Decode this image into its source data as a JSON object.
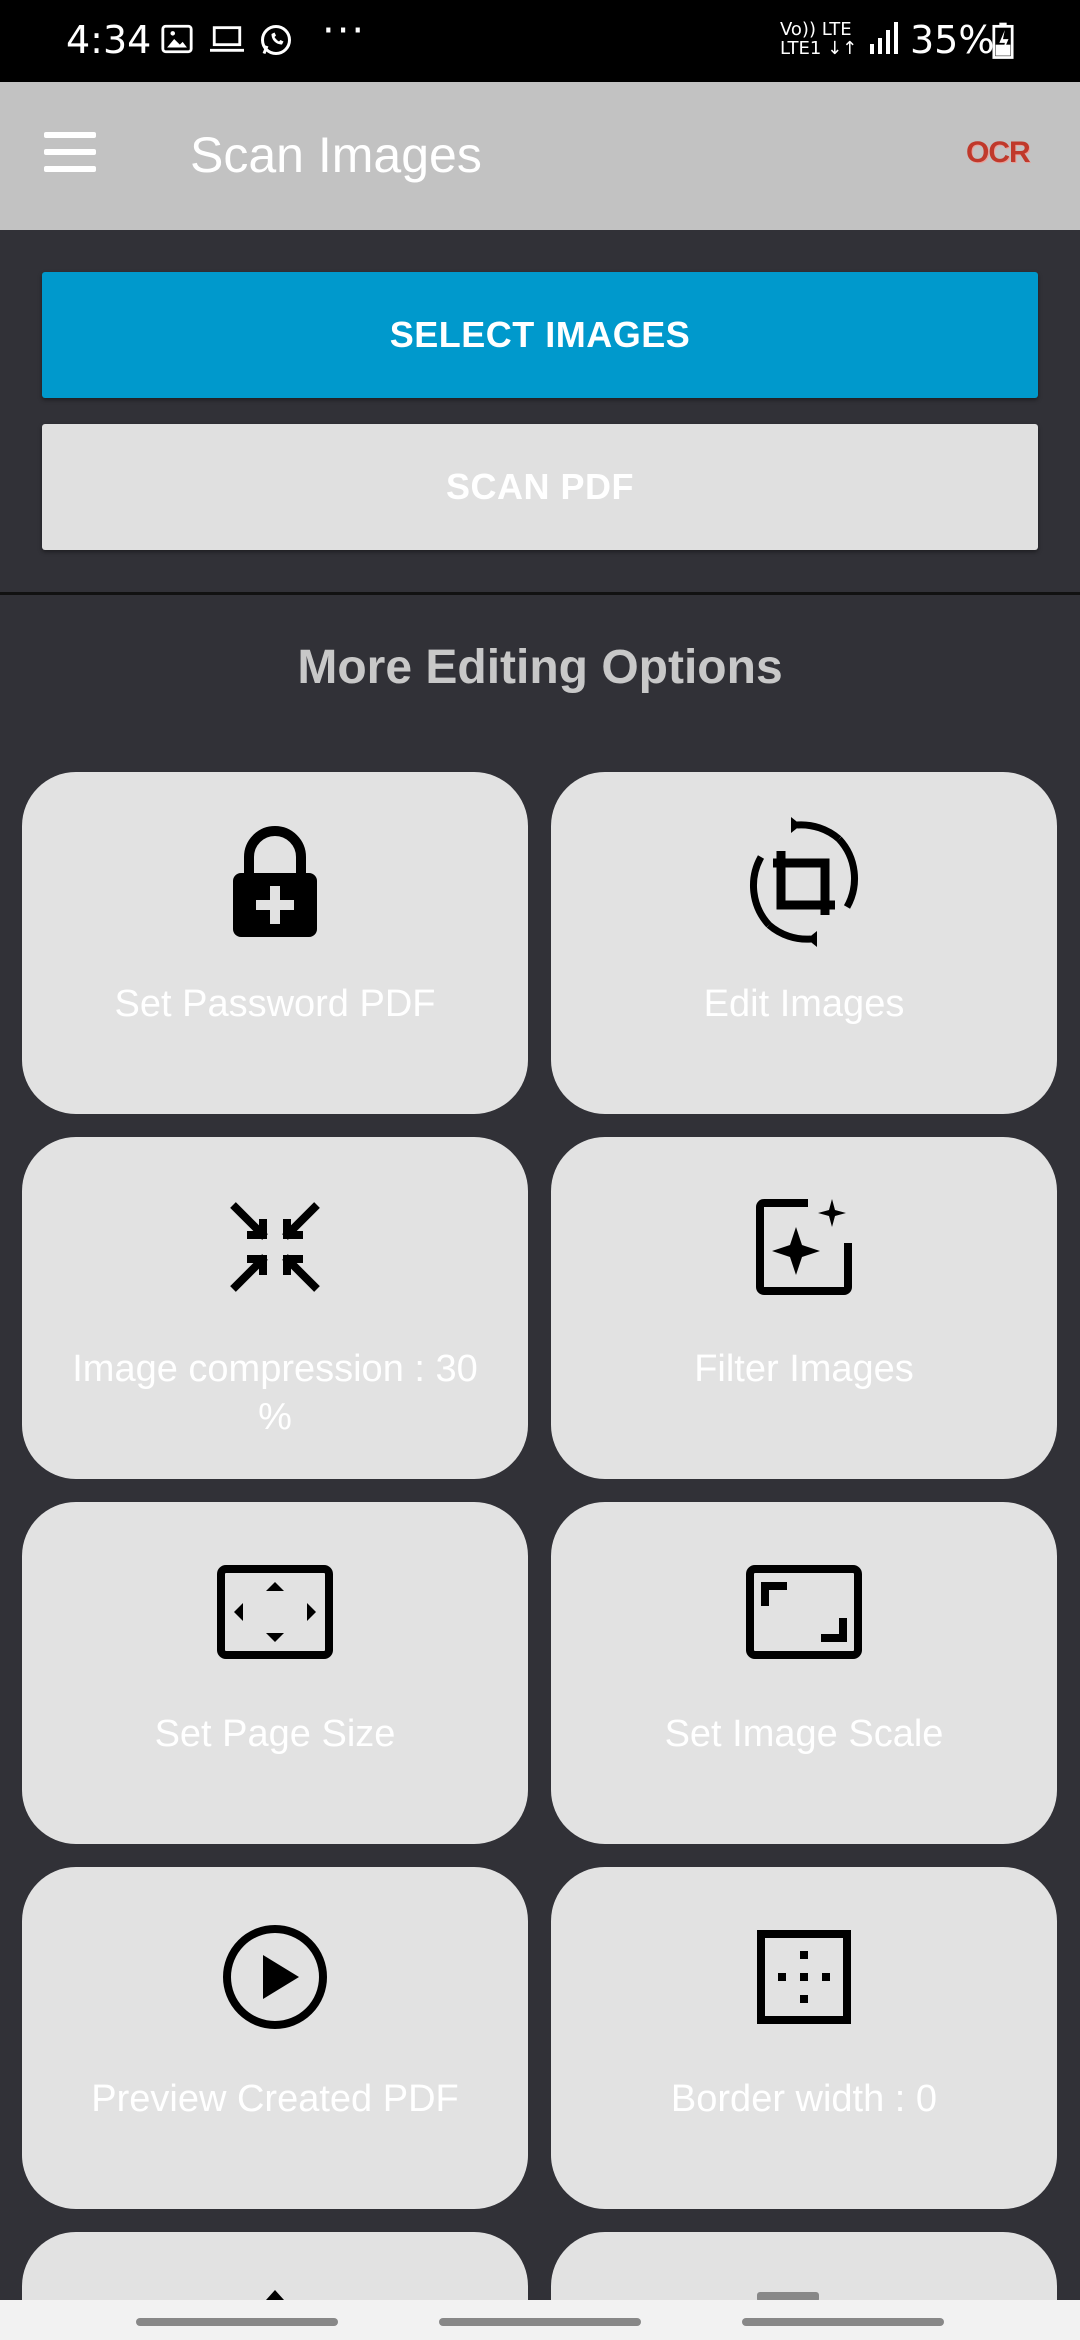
{
  "status_bar": {
    "time": "4:34",
    "network_line1": "Vo)) LTE",
    "network_line2": "LTE1 ↓↑",
    "battery": "35%",
    "more": "···"
  },
  "app_bar": {
    "title": "Scan Images",
    "ocr_label": "OCR"
  },
  "buttons": {
    "select_images": "SELECT IMAGES",
    "scan_pdf": "SCAN PDF"
  },
  "section_title": "More Editing Options",
  "cards": [
    {
      "label": "Set Password PDF",
      "icon": "lock-plus-icon"
    },
    {
      "label": "Edit Images",
      "icon": "crop-rotate-icon"
    },
    {
      "label": "Image compression : 30 %",
      "icon": "compress-arrows-icon"
    },
    {
      "label": "Filter Images",
      "icon": "image-sparkle-icon"
    },
    {
      "label": "Set Page Size",
      "icon": "page-size-icon"
    },
    {
      "label": "Set Image Scale",
      "icon": "aspect-ratio-icon"
    },
    {
      "label": "Preview Created PDF",
      "icon": "play-circle-icon"
    },
    {
      "label": "Border width : 0",
      "icon": "border-dots-icon"
    }
  ],
  "colors": {
    "background": "#313137",
    "app_bar": "#c2c2c2",
    "primary_button": "#0099cc",
    "card": "#e2e2e2",
    "ocr": "#c0392b"
  }
}
